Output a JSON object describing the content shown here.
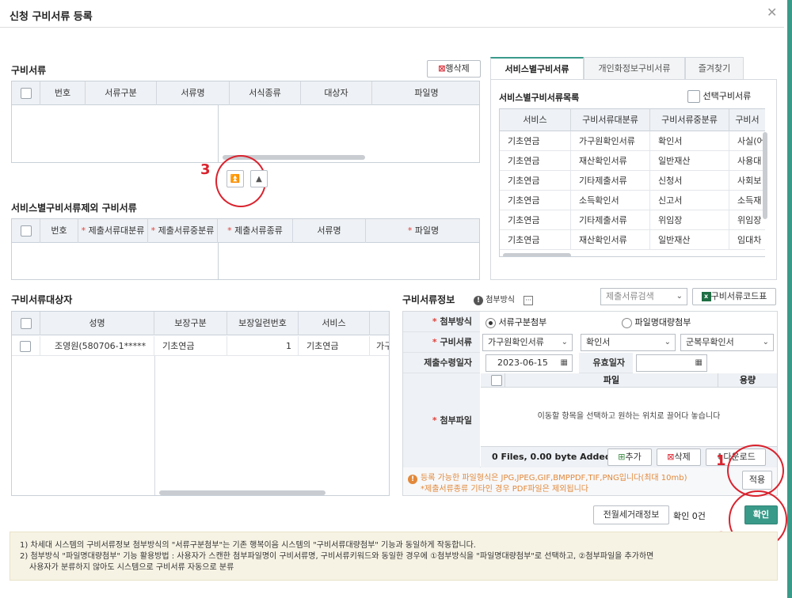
{
  "dialog": {
    "title": "신청 구비서류 등록",
    "close_icon": "close-icon"
  },
  "docs": {
    "title": "구비서류",
    "delete_btn": "행삭제",
    "headers": [
      "번호",
      "서류구분",
      "서류명",
      "서식종류",
      "대상자",
      "파일명"
    ]
  },
  "annotations": {
    "a1": "1",
    "a2": "2",
    "a3": "3"
  },
  "excluded": {
    "title": "서비스별구비서류제외 구비서류",
    "headers": [
      "번호",
      "제출서류대분류",
      "제출서류중분류",
      "제출서류종류",
      "서류명",
      "파일명"
    ]
  },
  "tabs": [
    "서비스별구비서류",
    "개인화정보구비서류",
    "즐겨찾기"
  ],
  "service_list": {
    "title": "서비스별구비서류목록",
    "checkbox_label": "선택구비서류",
    "headers": [
      "서비스",
      "구비서류대분류",
      "구비서류중분류",
      "구비서"
    ],
    "rows": [
      [
        "기초연금",
        "가구원확인서류",
        "확인서",
        "사실(어"
      ],
      [
        "기초연금",
        "재산확인서류",
        "일반재산",
        "사용대"
      ],
      [
        "기초연금",
        "기타제출서류",
        "신청서",
        "사회보"
      ],
      [
        "기초연금",
        "소득확인서",
        "신고서",
        "소득재"
      ],
      [
        "기초연금",
        "기타제출서류",
        "위임장",
        "위임장"
      ],
      [
        "기초연금",
        "재산확인서류",
        "일반재산",
        "임대차"
      ]
    ]
  },
  "targets": {
    "title": "구비서류대상자",
    "headers": [
      "성명",
      "보장구분",
      "보장일련번호",
      "서비스"
    ],
    "rows": [
      [
        "조영원(580706-1*****",
        "기초연금",
        "1",
        "기초연금",
        "가구"
      ]
    ]
  },
  "info": {
    "title": "구비서류정보",
    "attach_method_badge": "첨부방식",
    "search_placeholder": "제출서류검색",
    "code_btn": "구비서류코드표",
    "attach_label": "첨부방식",
    "radio1": "서류구분첨부",
    "radio2": "파일명대량첨부",
    "doc_label": "구비서류",
    "sel1": "가구원확인서류",
    "sel2": "확인서",
    "sel3": "군복무확인서",
    "date_label": "제출수령일자",
    "date_value": "2023-06-15",
    "valid_label": "유효일자",
    "file_label": "첨부파일",
    "file_headers": [
      "파일",
      "용량"
    ],
    "drop_msg": "이동할 항목을 선택하고 원하는 위치로 끌어다 놓습니다",
    "file_count": "0 Files, 0.00 byte Added",
    "add_btn": "추가",
    "del_btn": "삭제",
    "down_btn": "다운로드",
    "warn1": "등록 가능한 파일형식은 JPG,JPEG,GIF,BMPPDF,TIF,PNG입니다(최대 10mb)",
    "warn2": "*제출서류종류 기타인 경우 PDF파일은 제외됩니다",
    "apply_btn": "적용"
  },
  "footer": {
    "prev_btn": "전월세거래정보",
    "confirm_count": "확인 0건",
    "confirm_btn": "확인"
  },
  "notes": {
    "line1": "1) 차세대 시스템의 구비서류정보 첨부방식의 \"서류구분첨부\"는 기존 행복이음 시스템의 \"구비서류대량첨부\" 기능과 동일하게 작동합니다.",
    "line2": "2) 첨부방식 \"파일명대량첨부\" 기능 활용방법 : 사용자가 스캔한 첨부파일명이 구비서류명, 구비서류키워드와 동일한 경우에 ①첨부방식을 \"파일명대량첨부\"로 선택하고, ②첨부파일을 추가하면",
    "line3": "사용자가 분류하지 않아도 시스템으로 구비서류 자동으로 분류"
  },
  "colors": {
    "accent": "#3a9a8a",
    "annotation": "#d9232e",
    "required": "#e0423b"
  }
}
